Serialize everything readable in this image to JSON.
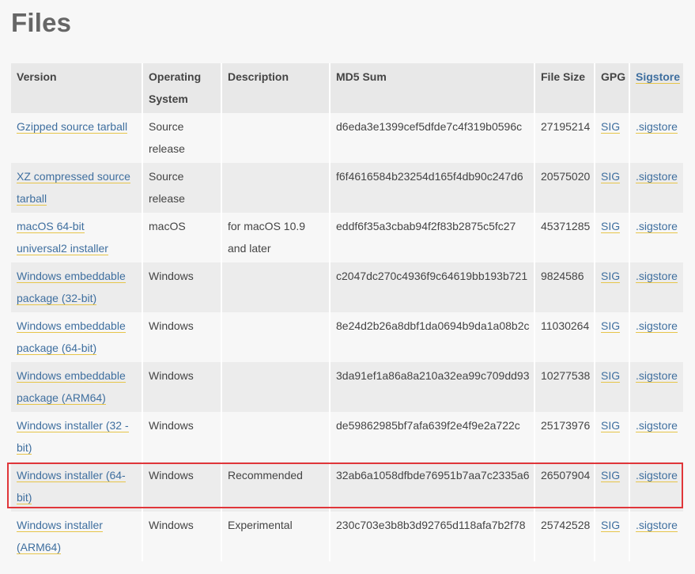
{
  "heading": "Files",
  "columns": {
    "version": "Version",
    "os": "Operating System",
    "description": "Description",
    "md5": "MD5 Sum",
    "size": "File Size",
    "gpg": "GPG",
    "sigstore": "Sigstore"
  },
  "rows": [
    {
      "version": "Gzipped source tarball",
      "os": "Source release",
      "description": "",
      "md5": "d6eda3e1399cef5dfde7c4f319b0596c",
      "size": "27195214",
      "gpg": "SIG",
      "sigstore": ".sigstore"
    },
    {
      "version": "XZ compressed source tarball",
      "os": "Source release",
      "description": "",
      "md5": "f6f4616584b23254d165f4db90c247d6",
      "size": "20575020",
      "gpg": "SIG",
      "sigstore": ".sigstore"
    },
    {
      "version": "macOS 64-bit universal2 installer",
      "os": "macOS",
      "description": "for macOS 10.9 and later",
      "md5": "eddf6f35a3cbab94f2f83b2875c5fc27",
      "size": "45371285",
      "gpg": "SIG",
      "sigstore": ".sigstore"
    },
    {
      "version": "Windows embeddable package (32-bit)",
      "os": "Windows",
      "description": "",
      "md5": "c2047dc270c4936f9c64619bb193b721",
      "size": "9824586",
      "gpg": "SIG",
      "sigstore": ".sigstore"
    },
    {
      "version": "Windows embeddable package (64-bit)",
      "os": "Windows",
      "description": "",
      "md5": "8e24d2b26a8dbf1da0694b9da1a08b2c",
      "size": "11030264",
      "gpg": "SIG",
      "sigstore": ".sigstore"
    },
    {
      "version": "Windows embeddable package (ARM64)",
      "os": "Windows",
      "description": "",
      "md5": "3da91ef1a86a8a210a32ea99c709dd93",
      "size": "10277538",
      "gpg": "SIG",
      "sigstore": ".sigstore"
    },
    {
      "version": "Windows installer (32 -bit)",
      "os": "Windows",
      "description": "",
      "md5": "de59862985bf7afa639f2e4f9e2a722c",
      "size": "25173976",
      "gpg": "SIG",
      "sigstore": ".sigstore"
    },
    {
      "version": "Windows installer (64-bit)",
      "os": "Windows",
      "description": "Recommended",
      "md5": "32ab6a1058dfbde76951b7aa7c2335a6",
      "size": "26507904",
      "gpg": "SIG",
      "sigstore": ".sigstore"
    },
    {
      "version": "Windows installer (ARM64)",
      "os": "Windows",
      "description": "Experimental",
      "md5": "230c703e3b8b3d92765d118afa7b2f78",
      "size": "25742528",
      "gpg": "SIG",
      "sigstore": ".sigstore"
    }
  ],
  "colors": {
    "link": "#3f6f9f",
    "link_underline": "#e6c54a",
    "highlight_border": "#e0363a"
  }
}
